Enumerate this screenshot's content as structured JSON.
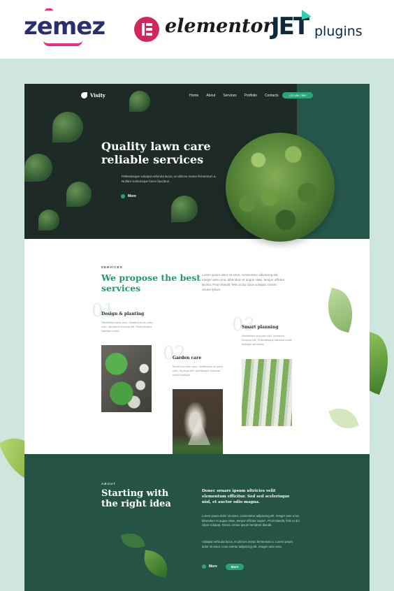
{
  "brands": {
    "zemez": "zemez",
    "elementor": "elementor",
    "jet": "JET",
    "plugins": "plugins"
  },
  "colors": {
    "accent": "#2aa57a",
    "dark_green": "#255447",
    "title_green": "#1f9a6c",
    "background": "#cfe6df"
  },
  "site": {
    "logo": "Visity",
    "nav": [
      "Home",
      "About",
      "Services",
      "Portfolio",
      "Contacts"
    ],
    "phone": "123-456-7890"
  },
  "hero": {
    "title": "Quality lawn care reliable services",
    "text": "Pellentesque volutpat vehicula lacus, et ultrices metus fermentum a. Nullam scelerisque fusce faucibus.",
    "more": "More"
  },
  "services": {
    "kicker": "SERVICES",
    "title": "We propose the best services",
    "description": "Lorem ipsum dolor sit amet, consectetur adipiscing elit. Integer ante urna, bibendum et augue vitae, tempor efficitur lacinia. Proin blandit, felis ut dui cibus volutpat. Donec ornare ipsum.",
    "items": [
      {
        "num": "01",
        "title": "Design & planting",
        "text": "Vestibulum sem arcu. Vestibulum at porta odio, hendrerit rhoncus elit. Pellentesque habitant morbi."
      },
      {
        "num": "02",
        "title": "Garden care",
        "text": "Morbi non sem arcu. Vestibulum at porta odio, rhoncus elit. Ulentesque habitant morbi tristique."
      },
      {
        "num": "03",
        "title": "Smart planning",
        "text": "Vestibulum at porta odio, hendrerit rhoncus elit. Pellentesque habitant morbi tristique senectus."
      }
    ]
  },
  "about": {
    "kicker": "ABOUT",
    "title": "Starting with the right idea",
    "lead": "Donec ornare ipsum ultricies velit elementum efficitur. Sed sed scelerisque nisl, et auctor odio magna.",
    "p1": "Lorem ipsum dolor sit amet, consectetur adipiscing elit. Integer ante urna, bibendum et augue vitae, tempor efficitur sapien. Proin blandit, felis ut dui cibus volutpat. Donec ornare ipsum hendrerit blandit.",
    "p2": "Volutpat vehicula lacus, et ultrices metus fermentum a. Lorem ipsum dolor sit amet, cons ectetur adipiscing elit. Integer ante urna.",
    "more": "More",
    "button": "More"
  }
}
